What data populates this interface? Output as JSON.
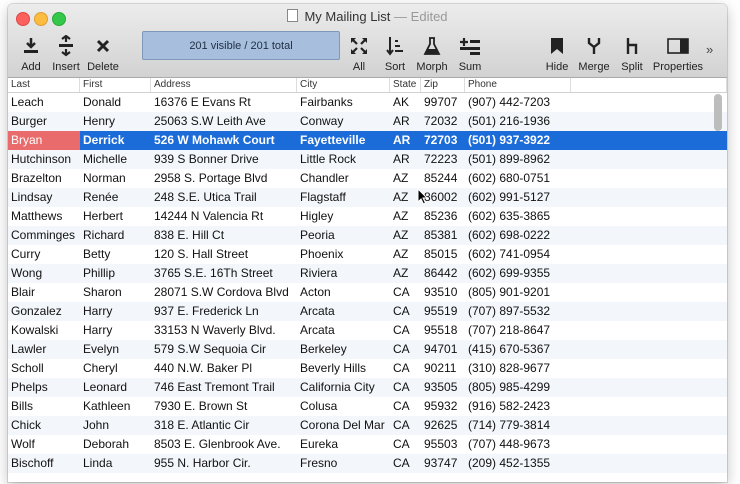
{
  "window": {
    "title": "My Mailing List",
    "status": "Edited"
  },
  "toolbar": {
    "add": "Add",
    "insert": "Insert",
    "delete": "Delete",
    "record_count": "201 visible / 201 total",
    "all": "All",
    "sort": "Sort",
    "morph": "Morph",
    "sum": "Sum",
    "hide": "Hide",
    "merge": "Merge",
    "split": "Split",
    "properties": "Properties",
    "more": "»"
  },
  "columns": [
    "Last",
    "First",
    "Address",
    "City",
    "State",
    "Zip",
    "Phone"
  ],
  "rows": [
    [
      "Leach",
      "Donald",
      "16376 E Evans Rt",
      "Fairbanks",
      "AK",
      "99707",
      "(907) 442-7203"
    ],
    [
      "Burger",
      "Henry",
      "25063 S.W Leith Ave",
      "Conway",
      "AR",
      "72032",
      "(501) 216-1936"
    ],
    [
      "Bryan",
      "Derrick",
      "526 W Mohawk Court",
      "Fayetteville",
      "AR",
      "72703",
      "(501) 937-3922"
    ],
    [
      "Hutchinson",
      "Michelle",
      "939 S Bonner Drive",
      "Little Rock",
      "AR",
      "72223",
      "(501) 899-8962"
    ],
    [
      "Brazelton",
      "Norman",
      "2958 S. Portage Blvd",
      "Chandler",
      "AZ",
      "85244",
      "(602) 680-0751"
    ],
    [
      "Lindsay",
      "Renée",
      "248 S.E. Utica Trail",
      "Flagstaff",
      "AZ",
      "86002",
      "(602) 991-5127"
    ],
    [
      "Matthews",
      "Herbert",
      "14244 N Valencia Rt",
      "Higley",
      "AZ",
      "85236",
      "(602) 635-3865"
    ],
    [
      "Comminges",
      "Richard",
      "838 E. Hill Ct",
      "Peoria",
      "AZ",
      "85381",
      "(602) 698-0222"
    ],
    [
      "Curry",
      "Betty",
      "120 S. Hall Street",
      "Phoenix",
      "AZ",
      "85015",
      "(602) 741-0954"
    ],
    [
      "Wong",
      "Phillip",
      "3765 S.E. 16Th Street",
      "Riviera",
      "AZ",
      "86442",
      "(602) 699-9355"
    ],
    [
      "Blair",
      "Sharon",
      "28071 S.W Cordova Blvd",
      "Acton",
      "CA",
      "93510",
      "(805) 901-9201"
    ],
    [
      "Gonzalez",
      "Harry",
      "937 E. Frederick Ln",
      "Arcata",
      "CA",
      "95519",
      "(707) 897-5532"
    ],
    [
      "Kowalski",
      "Harry",
      "33153 N Waverly Blvd.",
      "Arcata",
      "CA",
      "95518",
      "(707) 218-8647"
    ],
    [
      "Lawler",
      "Evelyn",
      "579 S.W Sequoia Cir",
      "Berkeley",
      "CA",
      "94701",
      "(415) 670-5367"
    ],
    [
      "Scholl",
      "Cheryl",
      "440 N.W. Baker Pl",
      "Beverly Hills",
      "CA",
      "90211",
      "(310) 828-9677"
    ],
    [
      "Phelps",
      "Leonard",
      "746 East Tremont Trail",
      "California City",
      "CA",
      "93505",
      "(805) 985-4299"
    ],
    [
      "Bills",
      "Kathleen",
      "7930 E. Brown St",
      "Colusa",
      "CA",
      "95932",
      "(916) 582-2423"
    ],
    [
      "Chick",
      "John",
      "318 E. Atlantic Cir",
      "Corona Del Mar",
      "CA",
      "92625",
      "(714) 779-3814"
    ],
    [
      "Wolf",
      "Deborah",
      "8503 E. Glenbrook Ave.",
      "Eureka",
      "CA",
      "95503",
      "(707) 448-9673"
    ],
    [
      "Bischoff",
      "Linda",
      "955 N. Harbor Cir.",
      "Fresno",
      "CA",
      "93747",
      "(209) 452-1355"
    ]
  ],
  "selected_row_index": 2,
  "colors": {
    "selection": "#1b6bd8",
    "selection_first_cell": "#ea6b6b",
    "count_box": "#a7bfdc"
  }
}
